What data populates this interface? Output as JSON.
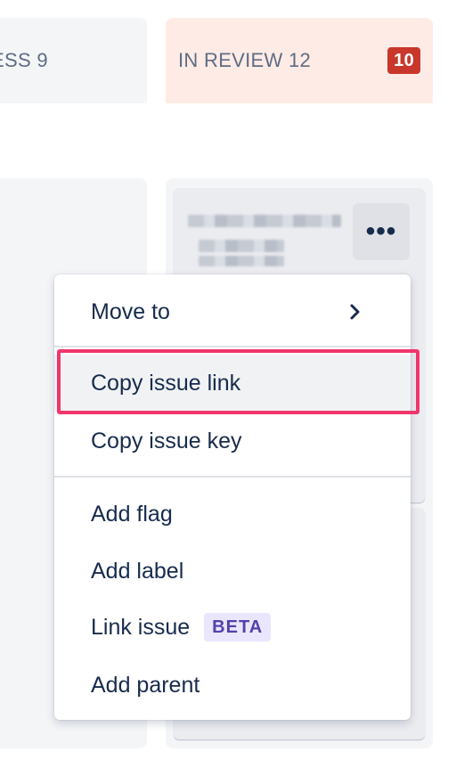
{
  "columns": {
    "left": {
      "title": "ESS 9"
    },
    "right": {
      "title": "IN REVIEW 12",
      "badge": "10"
    }
  },
  "card": {
    "more_label": "•••"
  },
  "menu": {
    "items": [
      {
        "label": "Move to",
        "has_submenu": true
      },
      {
        "label": "Copy issue link",
        "state": "highlighted"
      },
      {
        "label": "Copy issue key"
      },
      {
        "label": "Add flag"
      },
      {
        "label": "Add label"
      },
      {
        "label": "Link issue",
        "badge": "BETA"
      },
      {
        "label": "Add parent"
      }
    ]
  },
  "colors": {
    "review_header_bg": "#ffebe6",
    "badge_bg": "#c9372c",
    "beta_bg": "#eae6ff",
    "beta_text": "#5243aa",
    "highlight_border": "#f0356b"
  }
}
